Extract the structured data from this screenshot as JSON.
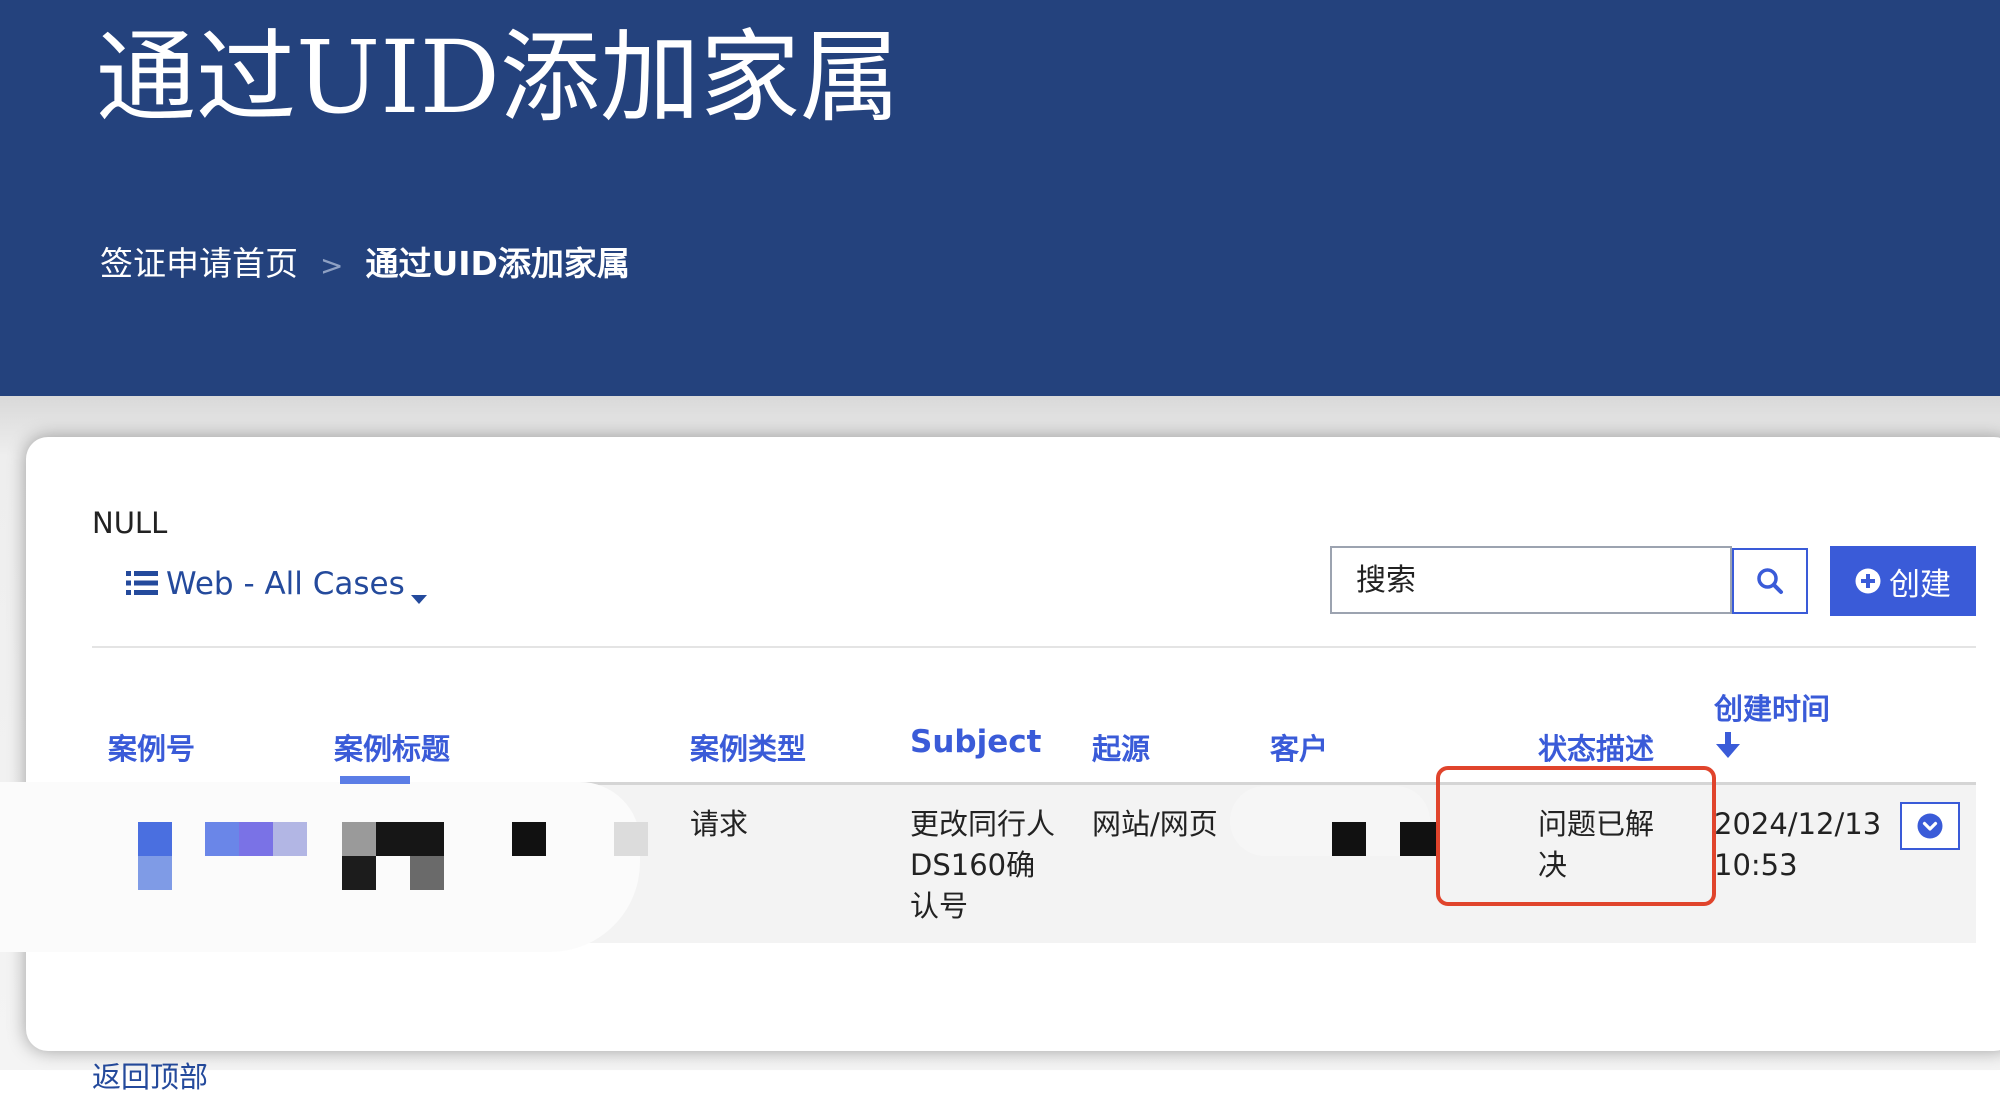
{
  "page_title": "通过UID添加家属",
  "breadcrumb": {
    "home": "签证申请首页",
    "separator": ">",
    "current": "通过UID添加家属"
  },
  "panel": {
    "null_label": "NULL",
    "view_selector": "Web - All Cases",
    "search_placeholder": "搜索",
    "create_label": "创建"
  },
  "table": {
    "columns": {
      "case_number": "案例号",
      "case_title": "案例标题",
      "case_type": "案例类型",
      "subject": "Subject",
      "origin": "起源",
      "customer": "客户",
      "status": "状态描述",
      "created": "创建时间"
    },
    "rows": [
      {
        "case_number": "",
        "case_title": "",
        "case_type": "请求",
        "subject": "更改同行人DS160确认号",
        "origin": "网站/网页",
        "customer": "",
        "status": "问题已解决",
        "created_date": "2024/12/13",
        "created_time": "10:53"
      }
    ]
  },
  "footer": {
    "back_to_top": "返回顶部"
  },
  "colors": {
    "hero_bg": "#24427d",
    "accent": "#3a5bd8",
    "highlight": "#e0442c"
  },
  "icons": {
    "view": "list-icon",
    "search": "search-icon",
    "create": "plus-circle-icon",
    "sort": "arrow-down-icon",
    "row_menu": "chevron-down-circle-icon"
  }
}
